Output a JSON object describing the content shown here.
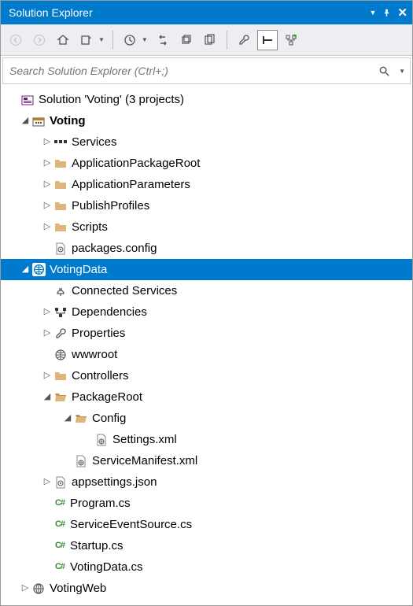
{
  "titlebar": {
    "title": "Solution Explorer"
  },
  "search": {
    "placeholder": "Search Solution Explorer (Ctrl+;)"
  },
  "solution": {
    "label": "Solution 'Voting' (3 projects)",
    "proj_voting": {
      "label": "Voting"
    },
    "voting_services": {
      "label": "Services"
    },
    "voting_app_pkg_root": {
      "label": "ApplicationPackageRoot"
    },
    "voting_app_params": {
      "label": "ApplicationParameters"
    },
    "voting_publish": {
      "label": "PublishProfiles"
    },
    "voting_scripts": {
      "label": "Scripts"
    },
    "voting_packages_config": {
      "label": "packages.config"
    },
    "proj_votingdata": {
      "label": "VotingData"
    },
    "vd_connected_services": {
      "label": "Connected Services"
    },
    "vd_dependencies": {
      "label": "Dependencies"
    },
    "vd_properties": {
      "label": "Properties"
    },
    "vd_wwwroot": {
      "label": "wwwroot"
    },
    "vd_controllers": {
      "label": "Controllers"
    },
    "vd_packageroot": {
      "label": "PackageRoot"
    },
    "vd_config": {
      "label": "Config"
    },
    "vd_settings_xml": {
      "label": "Settings.xml"
    },
    "vd_servicemanifest": {
      "label": "ServiceManifest.xml"
    },
    "vd_appsettings": {
      "label": "appsettings.json"
    },
    "vd_program_cs": {
      "label": "Program.cs"
    },
    "vd_serviceeventsource_cs": {
      "label": "ServiceEventSource.cs"
    },
    "vd_startup_cs": {
      "label": "Startup.cs"
    },
    "vd_votingdata_cs": {
      "label": "VotingData.cs"
    },
    "proj_votingweb": {
      "label": "VotingWeb"
    }
  }
}
